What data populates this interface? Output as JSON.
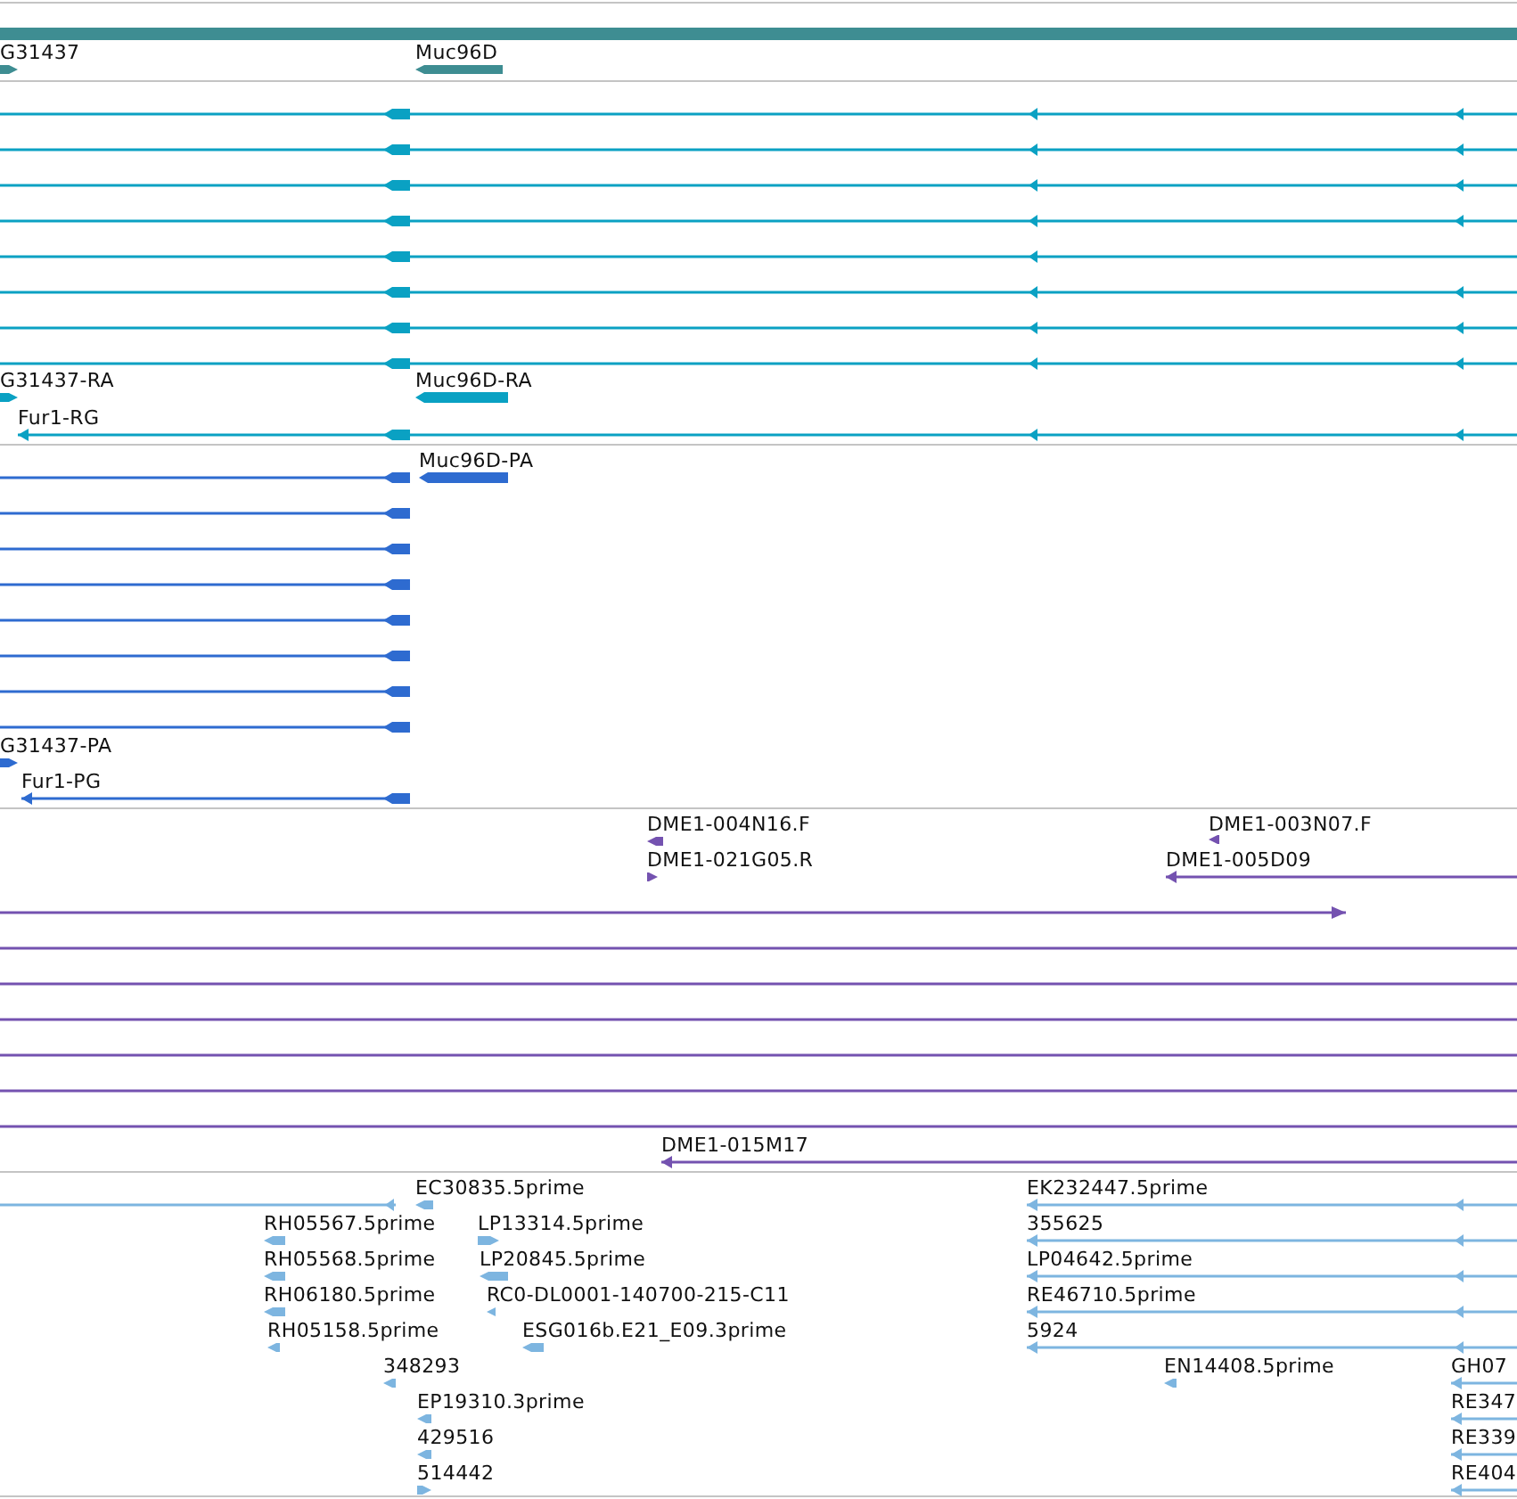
{
  "tracks": [
    {
      "color": "#3e8d92",
      "features": [
        {
          "kind": "bar"
        },
        {
          "label": "G31437",
          "kind": "bar",
          "reverse": false
        },
        {
          "label": "Muc96D",
          "kind": "bar",
          "reverse": true
        }
      ]
    },
    {
      "color": "#0aa1c3",
      "features": [
        {
          "kind": "line",
          "reverse": true
        },
        {
          "kind": "line",
          "reverse": true
        },
        {
          "kind": "line",
          "reverse": true
        },
        {
          "kind": "line",
          "reverse": true
        },
        {
          "kind": "line",
          "reverse": true
        },
        {
          "kind": "line",
          "reverse": true
        },
        {
          "kind": "line",
          "reverse": true
        },
        {
          "kind": "line",
          "reverse": true
        },
        {
          "label": "G31437-RA",
          "kind": "bar",
          "reverse": false
        },
        {
          "label": "Muc96D-RA",
          "kind": "bar",
          "reverse": true
        },
        {
          "label": "Fur1-RG",
          "kind": "line",
          "reverse": true
        }
      ]
    },
    {
      "color": "#2e6bd0",
      "features": [
        {
          "label": "Muc96D-PA",
          "kind": "bar",
          "reverse": true
        },
        {
          "kind": "line",
          "reverse": true
        },
        {
          "kind": "line",
          "reverse": true
        },
        {
          "kind": "line",
          "reverse": true
        },
        {
          "kind": "line",
          "reverse": true
        },
        {
          "kind": "line",
          "reverse": true
        },
        {
          "kind": "line",
          "reverse": true
        },
        {
          "kind": "line",
          "reverse": true
        },
        {
          "kind": "line",
          "reverse": true
        },
        {
          "label": "G31437-PA",
          "kind": "bar",
          "reverse": false
        },
        {
          "label": "Fur1-PG",
          "kind": "line",
          "reverse": true
        }
      ]
    },
    {
      "color": "#7452b0",
      "features": [
        {
          "label": "DME1-004N16.F",
          "kind": "bar",
          "reverse": true
        },
        {
          "label": "DME1-021G05.R",
          "kind": "bar",
          "reverse": false
        },
        {
          "label": "DME1-003N07.F",
          "kind": "bar",
          "reverse": true
        },
        {
          "label": "DME1-005D09",
          "kind": "line",
          "reverse": true
        },
        {
          "kind": "line",
          "reverse": false
        },
        {
          "kind": "line"
        },
        {
          "kind": "line"
        },
        {
          "kind": "line"
        },
        {
          "kind": "line"
        },
        {
          "kind": "line"
        },
        {
          "kind": "line"
        },
        {
          "label": "DME1-015M17",
          "kind": "line",
          "reverse": true
        }
      ]
    },
    {
      "color": "#7db5e0",
      "features": [
        {
          "kind": "line",
          "reverse": true
        },
        {
          "label": "EC30835.5prime",
          "kind": "bar",
          "reverse": true
        },
        {
          "label": "EK232447.5prime",
          "kind": "line",
          "reverse": true
        },
        {
          "label": "RH05567.5prime",
          "kind": "bar",
          "reverse": true
        },
        {
          "label": "LP13314.5prime",
          "kind": "bar",
          "reverse": false
        },
        {
          "label": "355625",
          "kind": "line",
          "reverse": true
        },
        {
          "label": "RH05568.5prime",
          "kind": "bar",
          "reverse": true
        },
        {
          "label": "LP20845.5prime",
          "kind": "bar",
          "reverse": true
        },
        {
          "label": "LP04642.5prime",
          "kind": "line",
          "reverse": true
        },
        {
          "label": "RH06180.5prime",
          "kind": "bar",
          "reverse": true
        },
        {
          "label": "RC0-DL0001-140700-215-C11",
          "kind": "bar",
          "reverse": true
        },
        {
          "label": "RE46710.5prime",
          "kind": "line",
          "reverse": true
        },
        {
          "label": "RH05158.5prime",
          "kind": "bar",
          "reverse": true
        },
        {
          "label": "ESG016b.E21_E09.3prime",
          "kind": "bar",
          "reverse": true
        },
        {
          "label": "5924",
          "kind": "line",
          "reverse": true
        },
        {
          "label": "348293",
          "kind": "bar",
          "reverse": true
        },
        {
          "label": "EN14408.5prime",
          "kind": "bar",
          "reverse": true
        },
        {
          "label": "GH07",
          "kind": "line",
          "reverse": true
        },
        {
          "label": "EP19310.3prime",
          "kind": "bar",
          "reverse": true
        },
        {
          "label": "RE347",
          "kind": "line",
          "reverse": true
        },
        {
          "label": "429516",
          "kind": "bar",
          "reverse": true
        },
        {
          "label": "RE339",
          "kind": "line",
          "reverse": true
        },
        {
          "label": "514442",
          "kind": "bar",
          "reverse": false
        },
        {
          "label": "RE404",
          "kind": "line",
          "reverse": true
        }
      ]
    }
  ]
}
